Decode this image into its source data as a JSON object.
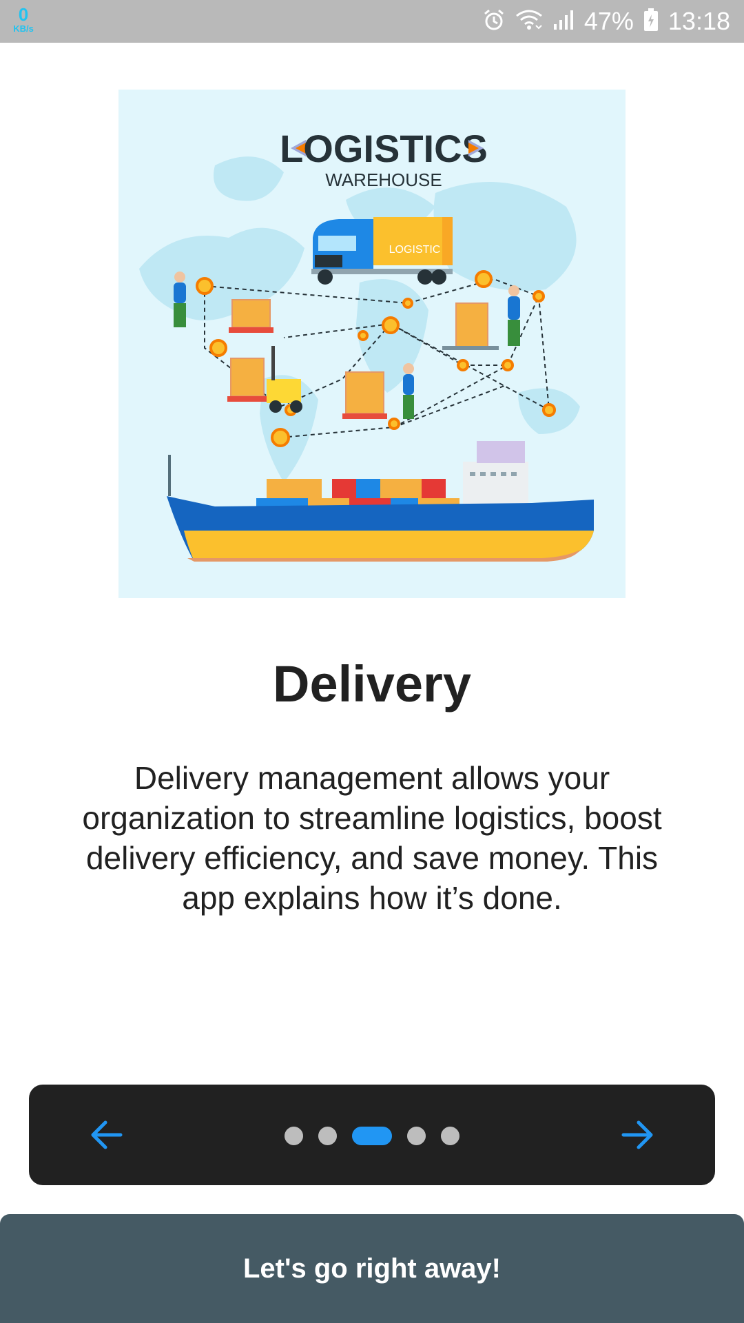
{
  "status_bar": {
    "net_speed": "0",
    "net_unit": "KB/s",
    "battery": "47%",
    "time": "13:18",
    "icons": [
      "alarm-icon",
      "wifi-icon",
      "signal-icon",
      "battery-icon"
    ]
  },
  "illustration": {
    "heading": "LOGISTICS",
    "subheading": "WAREHOUSE",
    "truck_label": "LOGISTIC"
  },
  "content": {
    "title": "Delivery",
    "description": "Delivery management allows your organization to streamline logistics, boost delivery efficiency, and save money. This app explains how it’s done."
  },
  "pager": {
    "total_pages": 5,
    "current_page": 3,
    "prev_icon": "arrow-left-icon",
    "next_icon": "arrow-right-icon"
  },
  "cta": {
    "label": "Let's go right away!"
  },
  "colors": {
    "accent": "#2196f3",
    "cta_bg": "#455a64",
    "pager_bg": "#212121",
    "status_bar": "#b9b9b9"
  }
}
